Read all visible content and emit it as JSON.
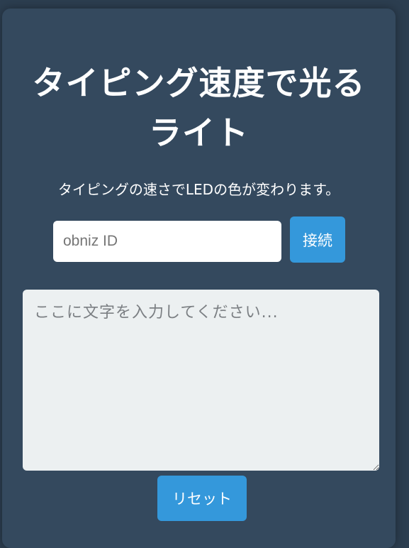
{
  "page": {
    "title_line1": "タイピング速度で光る",
    "title_line2": "ライト",
    "description": "タイピングの速さでLEDの色が変わります。"
  },
  "connection": {
    "id_placeholder": "obniz ID",
    "id_value": "",
    "connect_label": "接続"
  },
  "typing_area": {
    "placeholder": "ここに文字を入力してください...",
    "value": ""
  },
  "controls": {
    "reset_label": "リセット"
  },
  "colors": {
    "background": "#2c3e50",
    "card": "#34495e",
    "accent": "#3498db",
    "textarea_bg": "#ecf0f1"
  }
}
